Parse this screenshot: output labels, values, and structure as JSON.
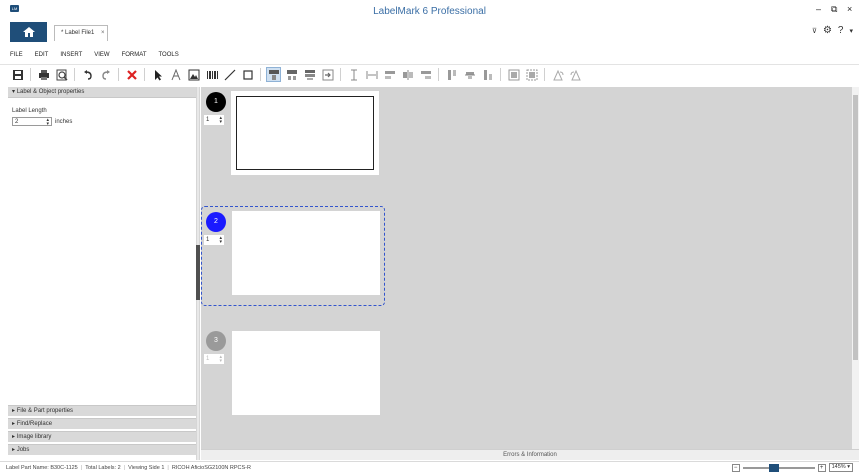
{
  "app": {
    "title": "LabelMark 6 Professional",
    "logo_text": "LM"
  },
  "window_controls": {
    "minimize": "–",
    "restore": "⧉",
    "close": "×"
  },
  "tabs": [
    {
      "label": "* Label File1",
      "close": "×"
    }
  ],
  "right_tools": {
    "pin": "⊽",
    "gear": "⚙",
    "help": "?",
    "help_caret": "▾"
  },
  "menu": [
    "FILE",
    "EDIT",
    "INSERT",
    "VIEW",
    "FORMAT",
    "TOOLS"
  ],
  "left_panel": {
    "section_title": "Label & Object properties",
    "label_length_caption": "Label Length",
    "label_length_value": "2",
    "label_length_unit": "inches",
    "collapsed_sections": [
      "File & Part properties",
      "Find/Replace",
      "Image library",
      "Jobs"
    ]
  },
  "labels": [
    {
      "number": "1",
      "copies": "1",
      "state": "active"
    },
    {
      "number": "2",
      "copies": "1",
      "state": "selected"
    },
    {
      "number": "3",
      "copies": "1",
      "state": "disabled"
    }
  ],
  "colors": {
    "brand": "#1f4e79",
    "selected": "#1a1aff",
    "active": "#000000",
    "disabled": "#9a9a9a"
  },
  "errors_bar": "Errors & Information",
  "status": {
    "part_name": "Label Part Name: B30C-1125",
    "total_labels": "Total Labels: 2",
    "viewing": "Viewing Side 1",
    "printer": "RICOH AficioSG2100N RPCS-R"
  },
  "zoom": {
    "minus": "−",
    "plus": "+",
    "value": "145%",
    "caret": "▾",
    "level_fraction": 0.42
  }
}
